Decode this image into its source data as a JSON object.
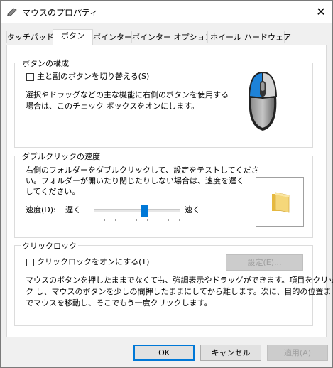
{
  "window": {
    "title": "マウスのプロパティ",
    "icon": "mouse-properties-icon",
    "close_glyph": "✕"
  },
  "tabs": [
    {
      "label": "タッチパッド",
      "active": false
    },
    {
      "label": "ボタン",
      "active": true
    },
    {
      "label": "ポインター",
      "active": false
    },
    {
      "label": "ポインター オプション",
      "active": false
    },
    {
      "label": "ホイール",
      "active": false
    },
    {
      "label": "ハードウェア",
      "active": false
    }
  ],
  "button_config": {
    "title": "ボタンの構成",
    "checkbox_label": "主と副のボタンを切り替える(S)",
    "checked": false,
    "description_line1": "選択やドラッグなどの主な機能に右側のボタンを使用する",
    "description_line2": "場合は、このチェック ボックスをオンにします。"
  },
  "double_click": {
    "title": "ダブルクリックの速度",
    "description_line1": "右側のフォルダーをダブルクリックして、設定をテストしてくださ",
    "description_line2": "い。フォルダーが開いたり閉じたりしない場合は、速度を遅く",
    "description_line3": "してください。",
    "speed_label": "速度(D):",
    "slow_label": "遅く",
    "fast_label": "速く",
    "slider_value": 0.6
  },
  "click_lock": {
    "title": "クリックロック",
    "checkbox_label": "クリックロックをオンにする(T)",
    "checked": false,
    "settings_button": "設定(E)...",
    "description_line1": "マウスのボタンを押したままでなくても、強調表示やドラッグができます。項目をクリッ",
    "description_line2": "ク し、マウスのボタンを少しの間押したままにしてから離します。次に、目的の位置ま",
    "description_line3": "でマウスを移動し、そこでもう一度クリックします。"
  },
  "footer": {
    "ok": "OK",
    "cancel": "キャンセル",
    "apply": "適用(A)"
  },
  "colors": {
    "accent": "#0078d7",
    "window_bg": "#f0f0f0",
    "panel_bg": "#ffffff",
    "folder": "#f5d77a"
  }
}
